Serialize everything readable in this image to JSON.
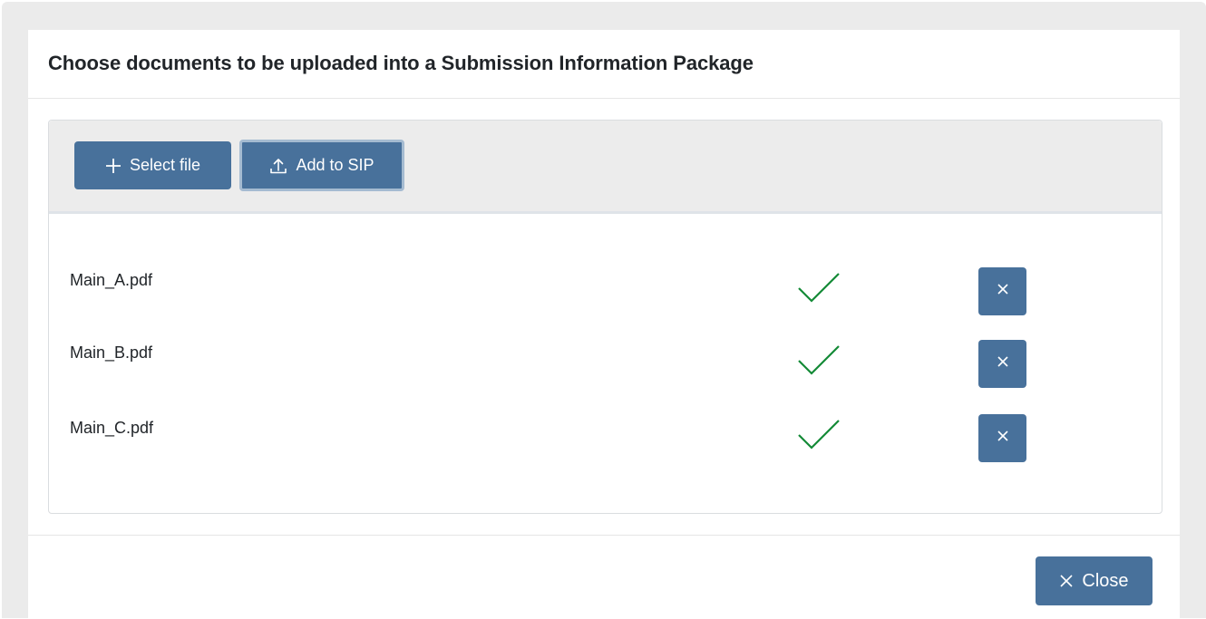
{
  "dialog": {
    "title": "Choose documents to be uploaded into a Submission Information Package"
  },
  "toolbar": {
    "select_file": {
      "label": "Select file",
      "icon": "plus-icon"
    },
    "add_to_sip": {
      "label": "Add to SIP",
      "icon": "upload-icon"
    }
  },
  "files": [
    {
      "name": "Main_A.pdf",
      "status": "uploaded",
      "status_icon": "check-icon",
      "remove_icon": "close-icon"
    },
    {
      "name": "Main_B.pdf",
      "status": "uploaded",
      "status_icon": "check-icon",
      "remove_icon": "close-icon"
    },
    {
      "name": "Main_C.pdf",
      "status": "uploaded",
      "status_icon": "check-icon",
      "remove_icon": "close-icon"
    }
  ],
  "footer": {
    "close": {
      "label": "Close",
      "icon": "close-icon"
    }
  },
  "colors": {
    "primary": "#48719b",
    "success": "#138a36",
    "frame": "#ebebeb"
  }
}
